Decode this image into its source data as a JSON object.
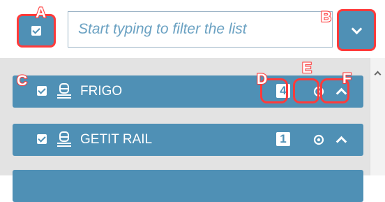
{
  "filter": {
    "placeholder": "Start typing to filter the list"
  },
  "rows": [
    {
      "label": "FRIGO",
      "count": "4"
    },
    {
      "label": "GETIT RAIL",
      "count": "1"
    }
  ],
  "markers": [
    "A",
    "B",
    "C",
    "D",
    "E",
    "F"
  ],
  "colors": {
    "accent": "#4f90b5",
    "highlight": "#ff3b3b",
    "list_background": "#e3e3e3"
  },
  "icons": [
    "checkbox-checked-icon",
    "train-icon",
    "eye-icon",
    "chevron-up-icon",
    "chevron-down-icon"
  ]
}
